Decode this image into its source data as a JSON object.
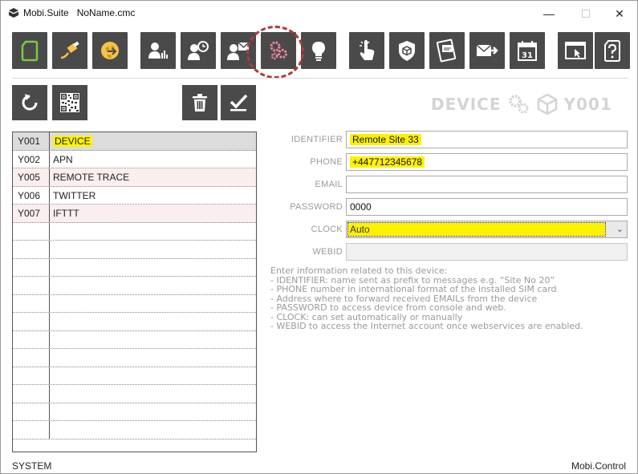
{
  "window": {
    "app_name": "Mobi.Suite",
    "file_name": "NoName.cmc",
    "min_symbol": "—",
    "max_symbol": "☐",
    "close_symbol": "✕"
  },
  "toolbar": {
    "buttons": [
      {
        "icon": "new-document-icon"
      },
      {
        "icon": "usb-cable-icon"
      },
      {
        "icon": "globe-network-icon"
      },
      {
        "icon": "user-chart-icon"
      },
      {
        "icon": "user-search-icon"
      },
      {
        "icon": "user-mail-icon"
      },
      {
        "icon": "gears-icon"
      },
      {
        "icon": "lightbulb-icon"
      },
      {
        "icon": "touch-hand-icon"
      },
      {
        "icon": "shield-cube-icon"
      },
      {
        "icon": "card-message-icon"
      },
      {
        "icon": "send-mail-icon"
      },
      {
        "icon": "calendar-icon"
      },
      {
        "icon": "window-cursor-icon"
      },
      {
        "icon": "help-document-icon"
      }
    ],
    "calendar_day": "31"
  },
  "actions": {
    "refresh": "refresh-icon",
    "qr": "qr-code-icon",
    "delete": "trash-icon",
    "apply": "check-apply-icon"
  },
  "header": {
    "section": "DEVICE",
    "code": "Y001"
  },
  "table": {
    "rows": [
      {
        "code": "Y001",
        "name": "DEVICE"
      },
      {
        "code": "Y002",
        "name": "APN"
      },
      {
        "code": "Y005",
        "name": "REMOTE TRACE"
      },
      {
        "code": "Y006",
        "name": "TWITTER"
      },
      {
        "code": "Y007",
        "name": "IFTTT"
      }
    ]
  },
  "form": {
    "identifier_label": "IDENTIFIER",
    "identifier_value": "Remote Site 33",
    "phone_label": "PHONE",
    "phone_value": "+447712345678",
    "email_label": "EMAIL",
    "email_value": "",
    "password_label": "PASSWORD",
    "password_value": "0000",
    "clock_label": "CLOCK",
    "clock_value": "Auto",
    "webid_label": "WEBID",
    "webid_value": ""
  },
  "help": {
    "lines": [
      "Enter information related to this device:",
      "- IDENTIFIER: name sent as prefix to messages e.g. “Site No 20”",
      "- PHONE number in international format of the installed SIM card",
      "- Address where to forward received EMAILs from the device",
      "- PASSWORD to access device from console and web.",
      "- CLOCK: can set automatically or manually",
      "- WEBID to access the Internet account once webservices are enabled."
    ]
  },
  "status": {
    "left": "SYSTEM",
    "right": "Mobi.Control"
  },
  "colors": {
    "toolbar_bg": "#4a4a4a",
    "icon_green": "#7ac943",
    "icon_yellow": "#f6c445",
    "icon_pink": "#f08aa0",
    "highlight": "#fff200"
  }
}
